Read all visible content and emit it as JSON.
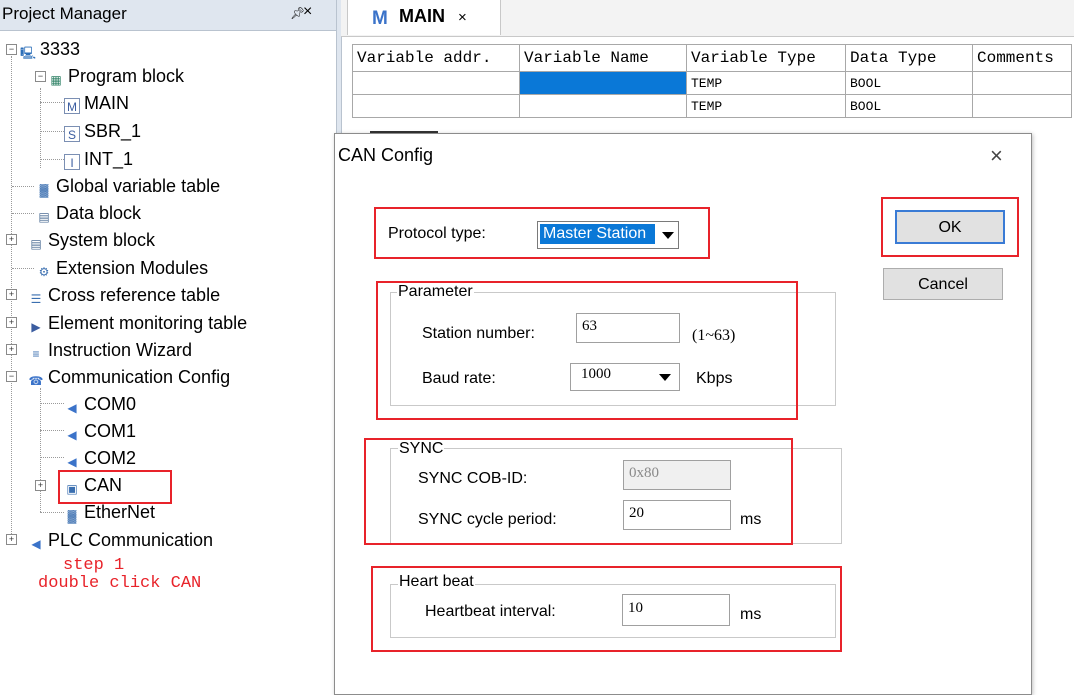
{
  "project_manager": {
    "title": "Project Manager",
    "pin": " →",
    "close": "×",
    "tree": {
      "root": "3333",
      "program_block": "Program block",
      "main": "MAIN",
      "sbr": "SBR_1",
      "int": "INT_1",
      "global_var": "Global variable table",
      "data_block": "Data block",
      "system_block": "System block",
      "extension": "Extension Modules",
      "cross_ref": "Cross reference table",
      "element_mon": "Element monitoring table",
      "instr_wizard": "Instruction Wizard",
      "comm_config": "Communication Config",
      "com0": "COM0",
      "com1": "COM1",
      "com2": "COM2",
      "can": "CAN",
      "ethernet": "EtherNet",
      "plc_comm": "PLC Communication"
    },
    "note_line1": "step 1",
    "note_line2": "double click CAN"
  },
  "editor": {
    "tab_icon": "M",
    "tab_label": "MAIN",
    "tab_close": "×",
    "columns": [
      "Variable addr.",
      "Variable Name",
      "Variable Type",
      "Data Type",
      "Comments"
    ],
    "rows": [
      {
        "addr": "",
        "name": "",
        "var_type": "TEMP",
        "data_type": "BOOL",
        "comment": ""
      },
      {
        "addr": "",
        "name": "",
        "var_type": "TEMP",
        "data_type": "BOOL",
        "comment": ""
      }
    ]
  },
  "dialog": {
    "title": "CAN Config",
    "close": "×",
    "protocol_label": "Protocol type:",
    "protocol_value": "Master Station",
    "ok": "OK",
    "cancel": "Cancel",
    "parameter": {
      "title": "Parameter",
      "station_label": "Station number:",
      "station_value": "63",
      "station_range": "(1~63)",
      "baud_label": "Baud rate:",
      "baud_value": "1000",
      "baud_unit": "Kbps"
    },
    "sync": {
      "title": "SYNC",
      "cobid_label": "SYNC  COB-ID:",
      "cobid_value": "0x80",
      "period_label": "SYNC cycle period:",
      "period_value": "20",
      "period_unit": "ms"
    },
    "heartbeat": {
      "title": "Heart beat",
      "interval_label": "Heartbeat interval:",
      "interval_value": "10",
      "interval_unit": "ms"
    }
  },
  "colors": {
    "highlight": "#e8232a",
    "selection": "#0a78d7",
    "panel_header": "#dfe6ef"
  }
}
